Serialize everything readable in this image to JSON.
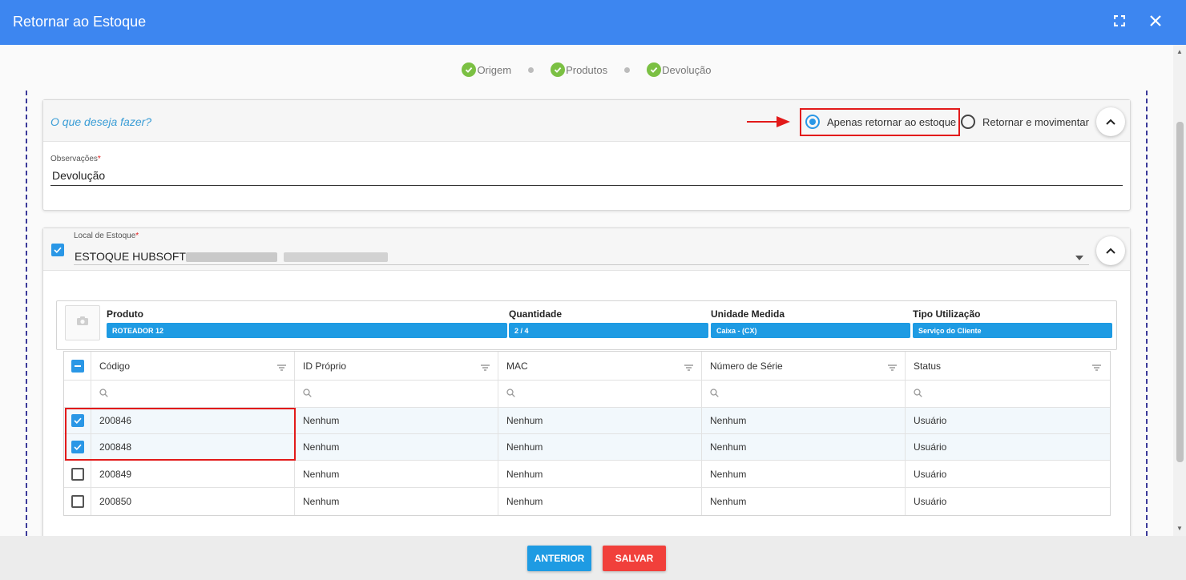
{
  "window": {
    "title": "Retornar ao Estoque"
  },
  "stepper": [
    "Origem",
    "Produtos",
    "Devolução"
  ],
  "action_card": {
    "question": "O que deseja fazer?",
    "options": [
      {
        "label": "Apenas retornar ao estoque",
        "selected": true
      },
      {
        "label": "Retornar e movimentar",
        "selected": false
      }
    ],
    "observacoes_label": "Observações",
    "required_mark": "*",
    "observacoes_value": "Devolução"
  },
  "stock_card": {
    "local_label": "Local de Estoque",
    "required_mark": "*",
    "local_value": "ESTOQUE HUBSOFT -",
    "product": {
      "headers": [
        "Produto",
        "Quantidade",
        "Unidade Medida",
        "Tipo Utilização"
      ],
      "values": [
        "ROTEADOR 12",
        "2 / 4",
        "Caixa - (CX)",
        "Serviço do Cliente"
      ]
    },
    "grid": {
      "columns": [
        "Código",
        "ID Próprio",
        "MAC",
        "Número de Série",
        "Status"
      ],
      "rows": [
        {
          "checked": true,
          "cells": [
            "200846",
            "Nenhum",
            "Nenhum",
            "Nenhum",
            "Usuário"
          ]
        },
        {
          "checked": true,
          "cells": [
            "200848",
            "Nenhum",
            "Nenhum",
            "Nenhum",
            "Usuário"
          ]
        },
        {
          "checked": false,
          "cells": [
            "200849",
            "Nenhum",
            "Nenhum",
            "Nenhum",
            "Usuário"
          ]
        },
        {
          "checked": false,
          "cells": [
            "200850",
            "Nenhum",
            "Nenhum",
            "Nenhum",
            "Usuário"
          ]
        }
      ]
    }
  },
  "footer": {
    "back_label": "ANTERIOR",
    "save_label": "SALVAR"
  },
  "colors": {
    "header": "#3d86f0",
    "accent": "#1e9be3",
    "success": "#7bc043",
    "danger": "#f1403b",
    "highlight": "#e21a1a"
  }
}
